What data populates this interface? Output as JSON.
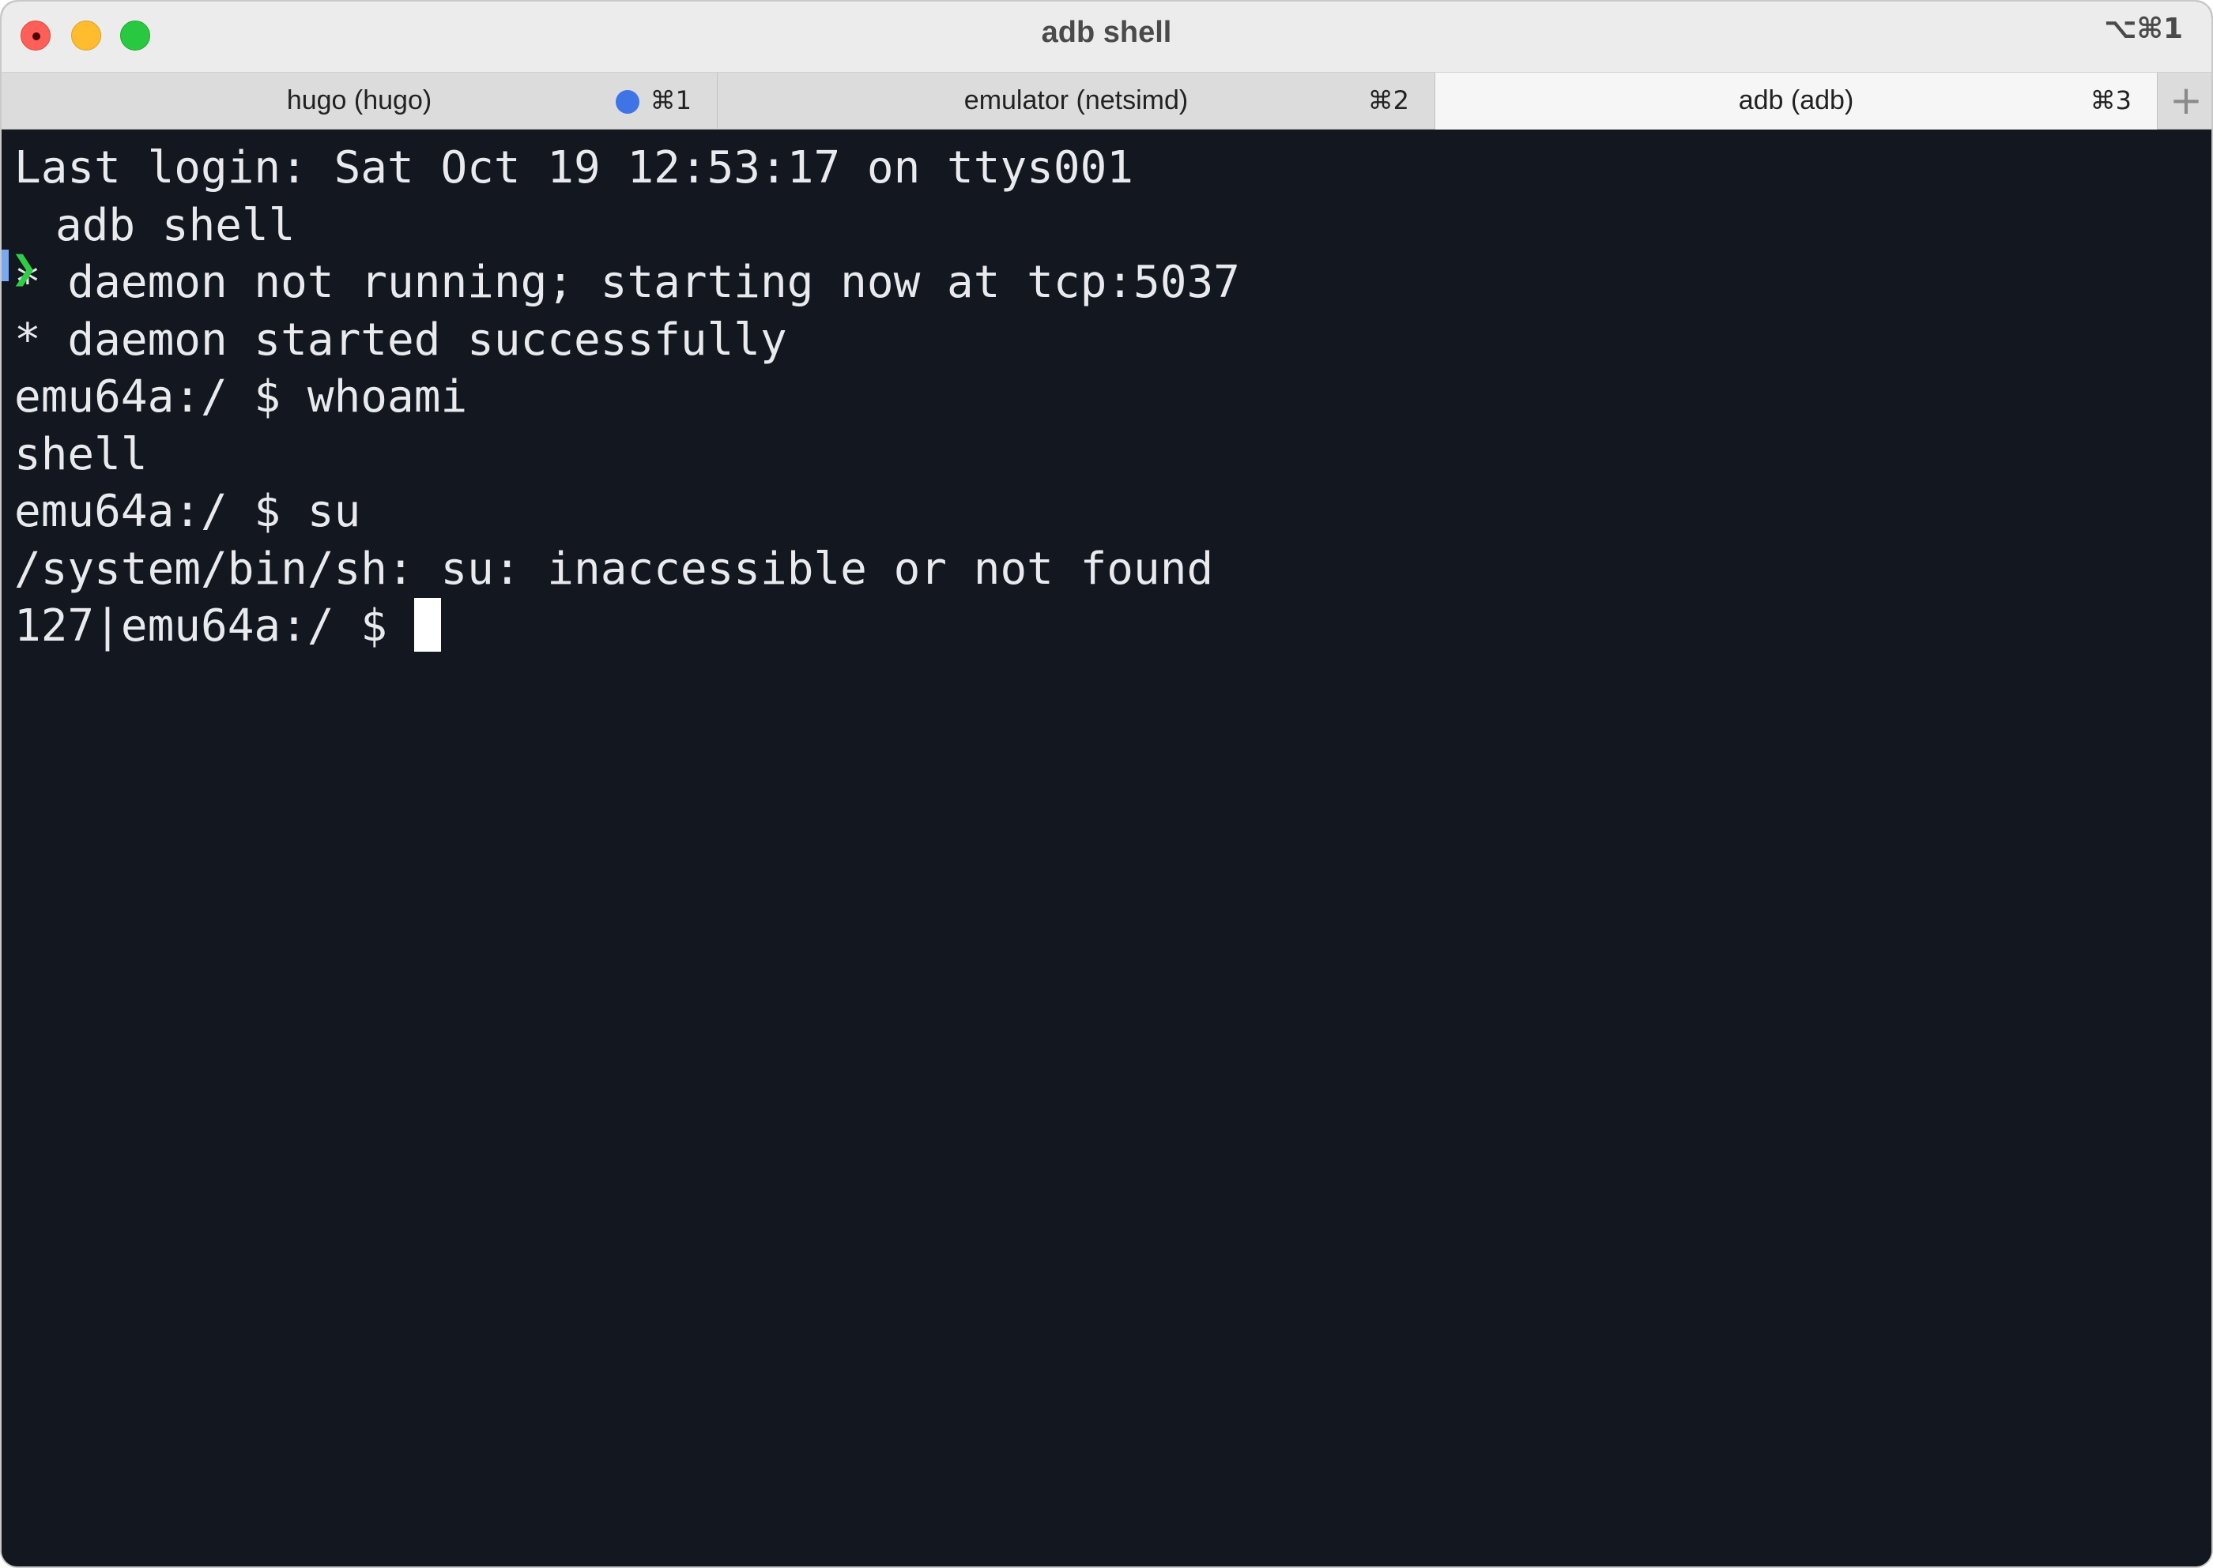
{
  "window": {
    "title": "adb shell",
    "shortcut": "⌥⌘1"
  },
  "tabs": [
    {
      "label": "hugo (hugo)",
      "shortcut": "⌘1",
      "has_activity_indicator": true,
      "active": false
    },
    {
      "label": "emulator (netsimd)",
      "shortcut": "⌘2",
      "has_activity_indicator": false,
      "active": false
    },
    {
      "label": "adb (adb)",
      "shortcut": "⌘3",
      "has_activity_indicator": false,
      "active": true
    }
  ],
  "new_tab_label": "+",
  "terminal": {
    "last_login": "Last login: Sat Oct 19 12:53:17 on ttys001",
    "prompt_symbol": "❯",
    "command": "adb shell",
    "lines": [
      "* daemon not running; starting now at tcp:5037",
      "* daemon started successfully",
      "emu64a:/ $ whoami",
      "shell",
      "emu64a:/ $ su",
      "/system/bin/sh: su: inaccessible or not found"
    ],
    "current_prompt": "127|emu64a:/ $ "
  },
  "colors": {
    "terminal_background": "#131720",
    "terminal_text": "#e8eaed",
    "prompt_arrow": "#2fcd46",
    "prompt_bar": "#7aa9f0",
    "activity_indicator": "#3f74e6",
    "traffic_close": "#ff5f57",
    "traffic_minimize": "#febc2e",
    "traffic_zoom": "#28c840"
  }
}
